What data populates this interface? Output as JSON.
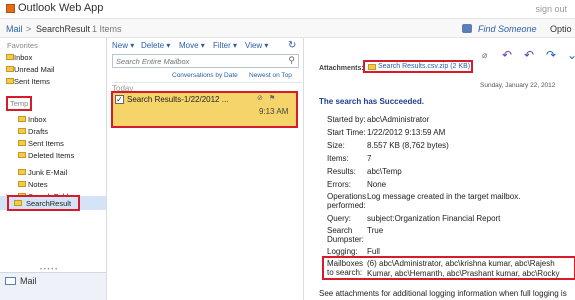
{
  "app": {
    "title": "Outlook Web App",
    "sign_out": "sign out"
  },
  "crumbs": {
    "mail": "Mail",
    "sep": ">",
    "folder": "SearchResult",
    "count": "1 Items",
    "find": "Find Someone",
    "options": "Optio"
  },
  "nav": {
    "favorites": "Favorites",
    "fav_items": [
      "Inbox",
      "Unread Mail",
      "Sent Items"
    ],
    "temp": "Temp",
    "temp_items": [
      "Inbox",
      "Drafts",
      "Sent Items",
      "Deleted Items",
      "Junk E-Mail",
      "Notes",
      "Search Folders",
      "SearchResult"
    ],
    "bottom_mail": "Mail",
    "dots": "• • • • •"
  },
  "toolbar": {
    "new": "New",
    "delete": "Delete",
    "move": "Move",
    "filter": "Filter",
    "view": "View"
  },
  "search": {
    "placeholder": "Search Entire Mailbox"
  },
  "conv": {
    "conv_label": "Conversations by Date",
    "newest": "Newest on Top"
  },
  "list": {
    "today": "Today",
    "subject": "Search Results-1/22/2012 ...",
    "time": "9:13 AM"
  },
  "reading": {
    "attachments_label": "Attachments:",
    "attachment": "Search Results.csv.zip (2 KB)",
    "date": "Sunday, January 22, 2012",
    "heading": "The search has Succeeded.",
    "rows": [
      {
        "k": "Started by:",
        "v": "abc\\Administrator"
      },
      {
        "k": "Start Time:",
        "v": "1/22/2012 9:13:59 AM"
      },
      {
        "k": "Size:",
        "v": "8.557 KB (8,762 bytes)"
      },
      {
        "k": "Items:",
        "v": "7"
      },
      {
        "k": "Results:",
        "v": "abc\\Temp"
      },
      {
        "k": "Errors:",
        "v": "None"
      },
      {
        "k": "Operations performed:",
        "v": "Log message created in the target mailbox."
      }
    ],
    "rows2": [
      {
        "k": "Query:",
        "v": "subject:Organization Financial Report"
      },
      {
        "k": "Search Dumpster:",
        "v": "True"
      },
      {
        "k": "Logging:",
        "v": "Full"
      }
    ],
    "mailboxes_label": "Mailboxes to search:",
    "mailboxes_line1": "(6) abc\\Administrator, abc\\krishna kumar, abc\\Rajesh",
    "mailboxes_line2": "Kumar, abc\\Hemanth, abc\\Prashant kumar, abc\\Rocky",
    "footer": "See attachments for additional logging information when full logging is"
  },
  "colors": {
    "accent": "#1f4e8c",
    "highlight": "#f5d56a",
    "red": "#d81b2b"
  }
}
